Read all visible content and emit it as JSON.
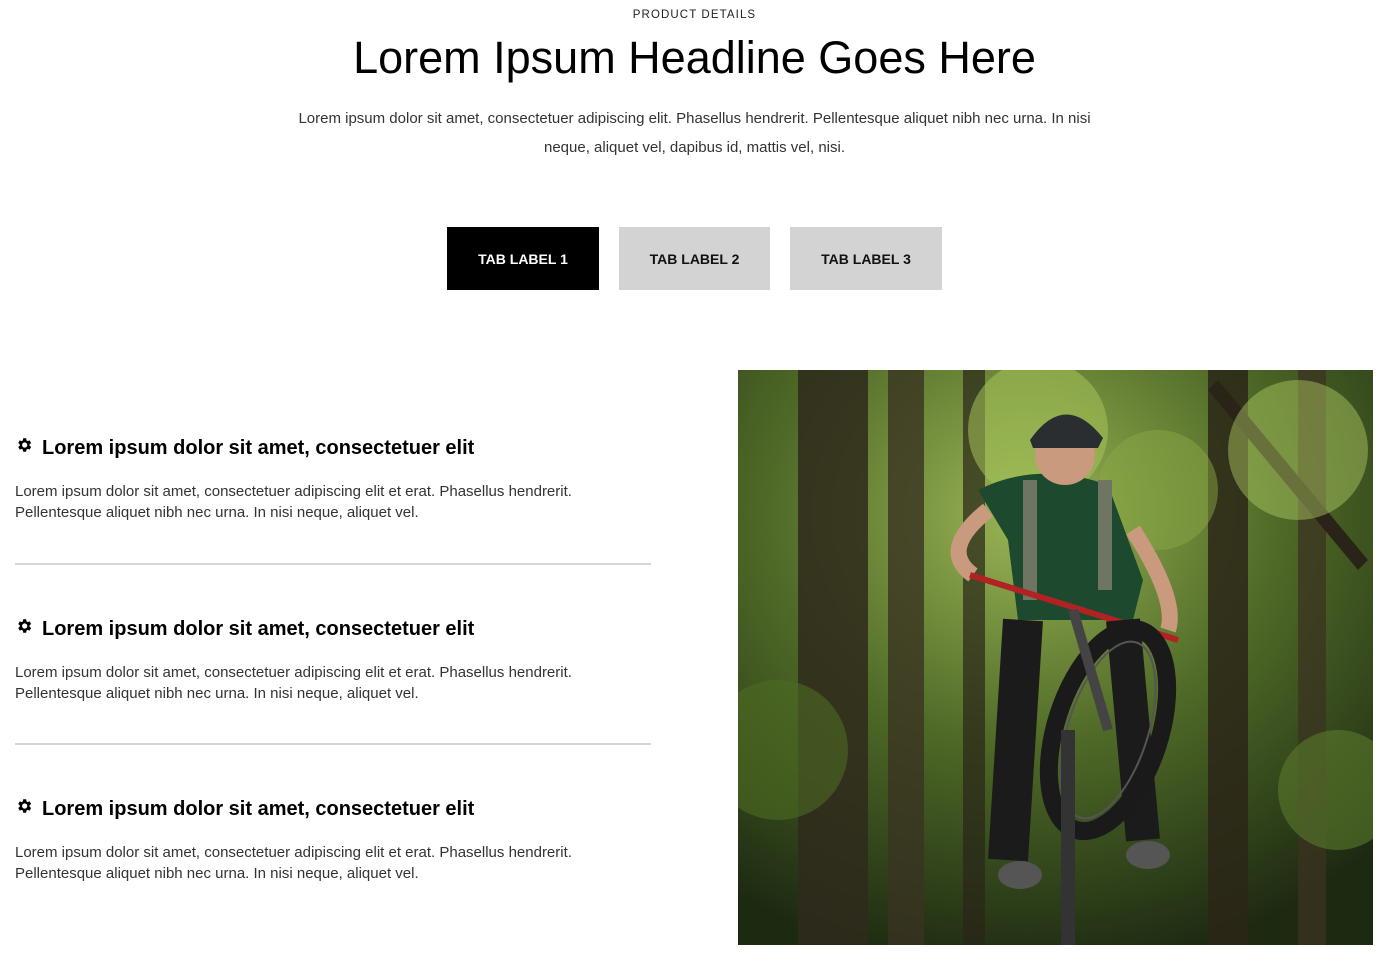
{
  "header": {
    "eyebrow": "PRODUCT DETAILS",
    "headline": "Lorem Ipsum Headline Goes Here",
    "intro": "Lorem ipsum dolor sit amet, consectetuer adipiscing elit. Phasellus hendrerit. Pellentesque aliquet nibh nec urna. In nisi neque, aliquet vel, dapibus id, mattis vel, nisi."
  },
  "tabs": [
    {
      "label": "TAB LABEL 1",
      "active": true
    },
    {
      "label": "TAB LABEL 2",
      "active": false
    },
    {
      "label": "TAB LABEL 3",
      "active": false
    }
  ],
  "features": [
    {
      "icon": "gear-icon",
      "title": "Lorem ipsum dolor sit amet, consectetuer elit",
      "text": "Lorem ipsum dolor sit amet, consectetuer adipiscing elit et erat. Phasellus hendrerit. Pellentesque aliquet nibh nec urna. In nisi neque, aliquet vel."
    },
    {
      "icon": "gear-icon",
      "title": "Lorem ipsum dolor sit amet, consectetuer elit",
      "text": "Lorem ipsum dolor sit amet, consectetuer adipiscing elit et erat. Phasellus hendrerit. Pellentesque aliquet nibh nec urna. In nisi neque, aliquet vel."
    },
    {
      "icon": "gear-icon",
      "title": "Lorem ipsum dolor sit amet, consectetuer elit",
      "text": "Lorem ipsum dolor sit amet, consectetuer adipiscing elit et erat. Phasellus hendrerit. Pellentesque aliquet nibh nec urna. In nisi neque, aliquet vel."
    }
  ],
  "colors": {
    "active_tab_bg": "#000000",
    "inactive_tab_bg": "#d3d3d3",
    "divider": "#d6d6d6"
  }
}
